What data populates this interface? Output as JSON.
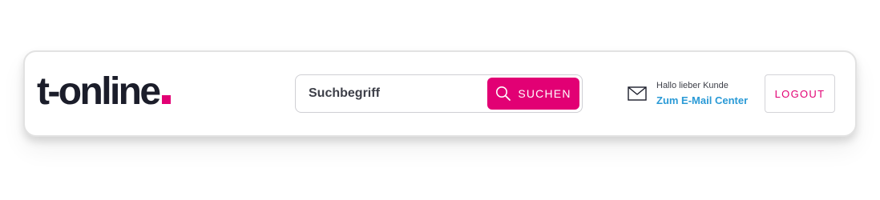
{
  "brand": {
    "logo_text": "t-online",
    "accent_color": "#e20074",
    "text_color": "#1b1d2a"
  },
  "search": {
    "placeholder": "Suchbegriff",
    "value": "",
    "button_label": "SUCHEN",
    "button_icon": "search-icon"
  },
  "mail": {
    "icon": "envelope-icon",
    "greeting": "Hallo lieber Kunde",
    "link_label": "Zum E-Mail Center",
    "link_color": "#2a9ad6"
  },
  "account": {
    "logout_label": "LOGOUT"
  }
}
